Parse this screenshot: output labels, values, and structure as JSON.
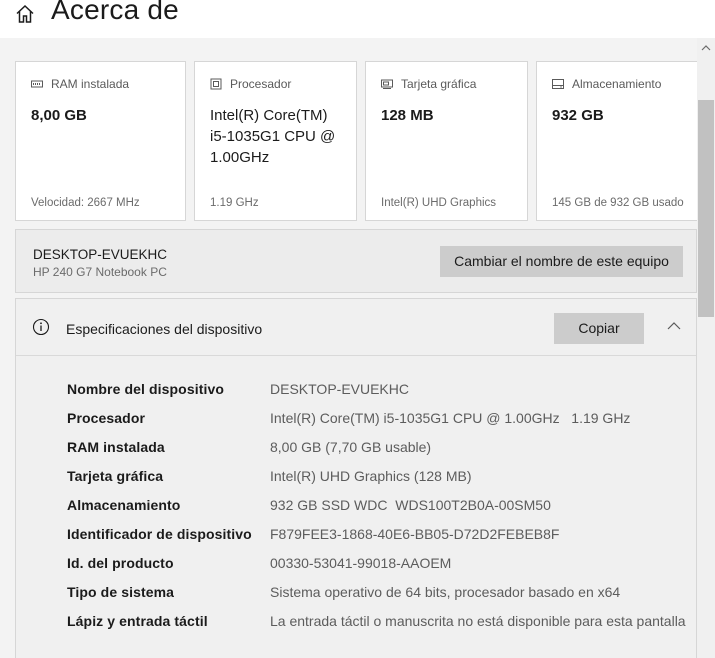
{
  "header": {
    "title": "Acerca de"
  },
  "cards": [
    {
      "label": "RAM instalada",
      "icon": "ram-icon",
      "value": "8,00 GB",
      "footer": "Velocidad: 2667 MHz"
    },
    {
      "label": "Procesador",
      "icon": "cpu-icon",
      "value": "Intel(R) Core(TM) i5-1035G1 CPU @ 1.00GHz",
      "footer": "1.19 GHz"
    },
    {
      "label": "Tarjeta gráfica",
      "icon": "gpu-icon",
      "value": "128 MB",
      "footer": "Intel(R) UHD Graphics"
    },
    {
      "label": "Almacenamiento",
      "icon": "storage-icon",
      "value": "932 GB",
      "footer": "145 GB de 932 GB usado"
    }
  ],
  "device": {
    "name": "DESKTOP-EVUEKHC",
    "model": "HP 240 G7 Notebook PC",
    "rename_label": "Cambiar el nombre de este equipo"
  },
  "specs": {
    "title": "Especificaciones del dispositivo",
    "copy_label": "Copiar",
    "rows": [
      {
        "label": "Nombre del dispositivo",
        "value": "DESKTOP-EVUEKHC"
      },
      {
        "label": "Procesador",
        "value": "Intel(R) Core(TM) i5-1035G1 CPU @ 1.00GHz   1.19 GHz"
      },
      {
        "label": "RAM instalada",
        "value": "8,00 GB (7,70 GB usable)"
      },
      {
        "label": "Tarjeta gráfica",
        "value": "Intel(R) UHD Graphics (128 MB)"
      },
      {
        "label": "Almacenamiento",
        "value": "932 GB SSD WDC  WDS100T2B0A-00SM50"
      },
      {
        "label": "Identificador de dispositivo",
        "value": "F879FEE3-1868-40E6-BB05-D72D2FEBEB8F"
      },
      {
        "label": "Id. del producto",
        "value": "00330-53041-99018-AAOEM"
      },
      {
        "label": "Tipo de sistema",
        "value": "Sistema operativo de 64 bits, procesador basado en x64"
      },
      {
        "label": "Lápiz y entrada táctil",
        "value": "La entrada táctil o manuscrita no está disponible para esta pantalla"
      }
    ]
  }
}
